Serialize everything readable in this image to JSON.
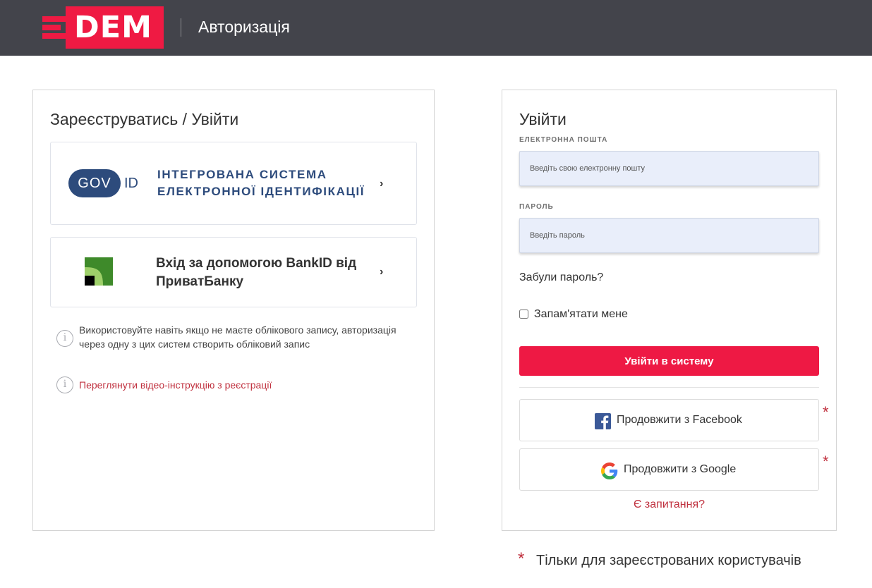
{
  "header": {
    "logo_text": "DEM",
    "title": "Авторизація"
  },
  "left": {
    "title": "Зареєструватись / Увійти",
    "govid": {
      "gov": "GOV",
      "id": "ID",
      "description": "Інтегрована система електронної ідентифікації"
    },
    "bankid": {
      "text": "Вхід за допомогою BankID від ПриватБанку"
    },
    "info_note": "Використовуйте навіть якщо не маєте облікового запису, авторизація через одну з цих систем створить обліковий запис",
    "video_link": "Переглянути відео-інструкцію з реєстрації"
  },
  "login": {
    "title": "Увійти",
    "email_label": "ЕЛЕКТРОННА ПОШТА",
    "email_placeholder": "Введіть свою електронну пошту",
    "password_label": "ПАРОЛЬ",
    "password_placeholder": "Введіть пароль",
    "forgot": "Забули пароль?",
    "remember": "Запам'ятати мене",
    "submit": "Увійти в систему",
    "facebook": "Продовжити з Facebook",
    "google": "Продовжити з Google",
    "question": "Є запитання?"
  },
  "footnote": {
    "star": "*",
    "text": "Тільки для зареєстрованих користувачів"
  },
  "colors": {
    "accent": "#ee1944",
    "header_bg": "#43444b",
    "gov_blue": "#2d4b7c",
    "link_red": "#c0313f"
  }
}
